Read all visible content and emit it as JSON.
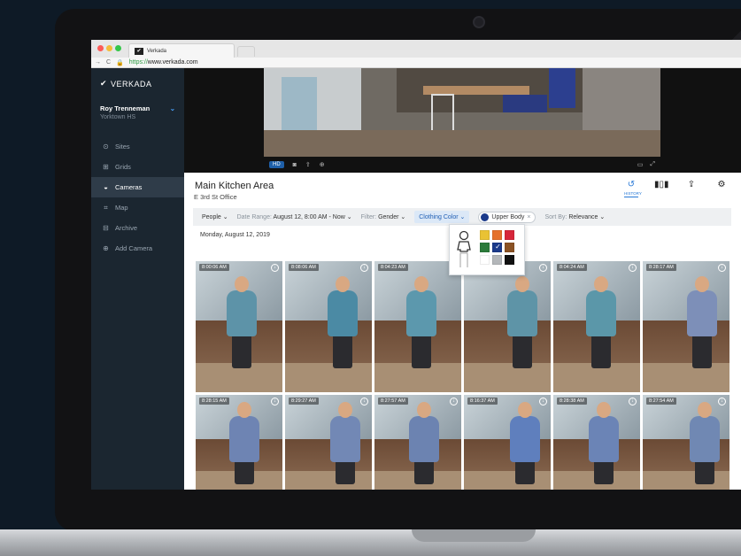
{
  "browser": {
    "tab_title": "Verkada",
    "url_scheme": "https://",
    "url_host": "www.verkada.com"
  },
  "sidebar": {
    "brand": "VERKADA",
    "user_name": "Roy Trenneman",
    "user_site": "Yorktown HS",
    "items": [
      {
        "label": "Sites",
        "icon": "location-pin-icon",
        "active": false
      },
      {
        "label": "Grids",
        "icon": "grid-icon",
        "active": false
      },
      {
        "label": "Cameras",
        "icon": "camera-icon",
        "active": true
      },
      {
        "label": "Map",
        "icon": "map-icon",
        "active": false
      },
      {
        "label": "Archive",
        "icon": "archive-icon",
        "active": false
      },
      {
        "label": "Add Camera",
        "icon": "plus-circle-icon",
        "active": false
      }
    ]
  },
  "player": {
    "quality": "HD"
  },
  "header": {
    "title": "Main Kitchen Area",
    "subtitle": "E 3rd St Office",
    "history_label": "HISTORY"
  },
  "filters": {
    "people": "People",
    "date_range_label": "Date Range:",
    "date_range_value": "August 12, 8:00 AM - Now",
    "filter_label": "Filter:",
    "gender": "Gender",
    "clothing": "Clothing Color",
    "chip": "Upper Body",
    "sort_label": "Sort By:",
    "sort_value": "Relevance"
  },
  "date_heading": "Monday, August 12, 2019",
  "color_popover": {
    "swatches": [
      "#e9c234",
      "#e5712c",
      "#d6263a",
      "#2b7a3a",
      "#1b3a8a",
      "#8a5224",
      "#ffffff",
      "#b4b7ba",
      "#111111"
    ],
    "selected_index": 4
  },
  "results": [
    {
      "time": "8:00:06 AM",
      "shirt": "#5d93a8"
    },
    {
      "time": "8:08:06 AM",
      "shirt": "#4b8aa4"
    },
    {
      "time": "8:04:23 AM",
      "shirt": "#5c98ad"
    },
    {
      "time": "",
      "shirt": "#5e94a7"
    },
    {
      "time": "8:04:24 AM",
      "shirt": "#5b97a9"
    },
    {
      "time": "8:28:17 AM",
      "shirt": "#7d8fb8"
    },
    {
      "time": "8:28:15 AM",
      "shirt": "#6e84b3"
    },
    {
      "time": "8:29:27 AM",
      "shirt": "#7288b5"
    },
    {
      "time": "8:27:57 AM",
      "shirt": "#6c83b1"
    },
    {
      "time": "8:16:37 AM",
      "shirt": "#5f7fbd"
    },
    {
      "time": "8:28:38 AM",
      "shirt": "#6b84b6"
    },
    {
      "time": "8:27:54 AM",
      "shirt": "#7088b3"
    }
  ]
}
